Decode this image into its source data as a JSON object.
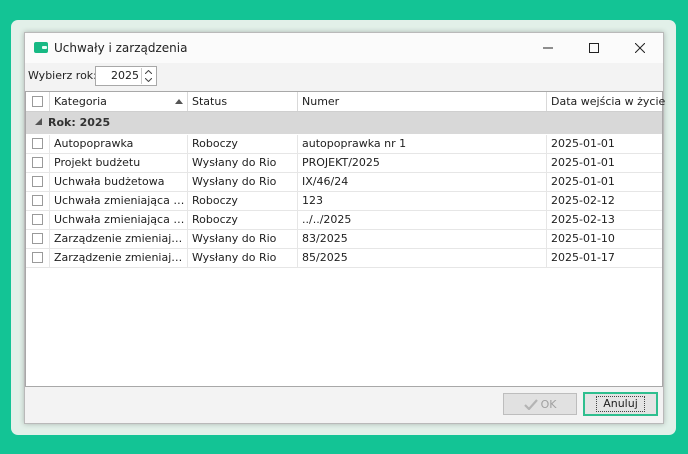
{
  "window": {
    "title": "Uchwały i zarządzenia"
  },
  "year_picker": {
    "label": "Wybierz rok:",
    "value": "2025"
  },
  "table": {
    "columns": [
      "Kategoria",
      "Status",
      "Numer",
      "Data wejścia w życie"
    ],
    "sort_column": "Kategoria",
    "group_label": "Rok: 2025",
    "rows": [
      {
        "kategoria": "Autopoprawka",
        "status": "Roboczy",
        "numer": "autopoprawka nr 1",
        "data": "2025-01-01"
      },
      {
        "kategoria": "Projekt budżetu",
        "status": "Wysłany do Rio",
        "numer": "PROJEKT/2025",
        "data": "2025-01-01"
      },
      {
        "kategoria": "Uchwała budżetowa",
        "status": "Wysłany do Rio",
        "numer": "IX/46/24",
        "data": "2025-01-01"
      },
      {
        "kategoria": "Uchwała zmieniająca budżet",
        "status": "Roboczy",
        "numer": "123",
        "data": "2025-02-12"
      },
      {
        "kategoria": "Uchwała zmieniająca budżet",
        "status": "Roboczy",
        "numer": "../../2025",
        "data": "2025-02-13"
      },
      {
        "kategoria": "Zarządzenie zmieniające budżet",
        "status": "Wysłany do Rio",
        "numer": "83/2025",
        "data": "2025-01-10"
      },
      {
        "kategoria": "Zarządzenie zmieniające budżet",
        "status": "Wysłany do Rio",
        "numer": "85/2025",
        "data": "2025-01-17"
      }
    ]
  },
  "footer": {
    "ok_label": "OK",
    "cancel_label": "Anuluj"
  },
  "colors": {
    "background": "#13c495",
    "accent": "#2fbf8f",
    "group_band": "#d8d8d8"
  }
}
